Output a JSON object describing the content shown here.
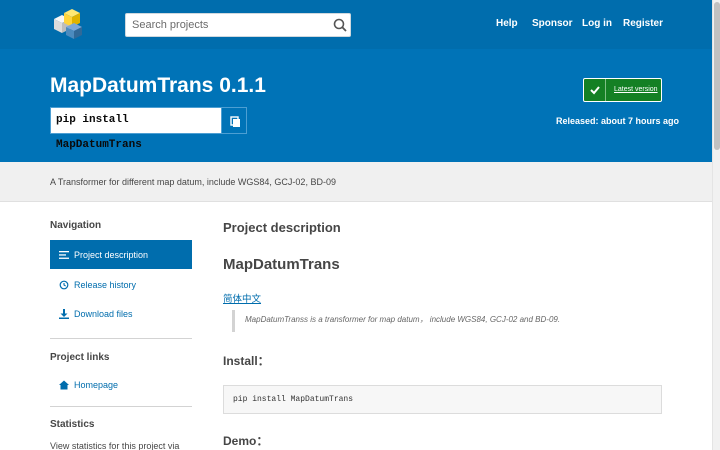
{
  "header": {
    "logo_icon": "pypi-logo-icon",
    "search_placeholder": "Search projects",
    "search_icon": "search-icon",
    "nav": [
      "Help",
      "Sponsor",
      "Log in",
      "Register"
    ]
  },
  "hero": {
    "title": "MapDatumTrans 0.1.1",
    "pip_command": "pip install MapDatumTrans",
    "copy_icon": "copy-icon",
    "latest_label": "Latest version",
    "latest_icon": "check-icon",
    "released": "Released: about 7 hours ago"
  },
  "summary": "A Transformer for different map datum, include WGS84, GCJ-02, BD-09",
  "sidebar": {
    "navigation_heading": "Navigation",
    "nav_items": [
      {
        "label": "Project description",
        "icon": "list-icon",
        "active": true
      },
      {
        "label": "Release history",
        "icon": "history-icon",
        "active": false
      },
      {
        "label": "Download files",
        "icon": "download-icon",
        "active": false
      }
    ],
    "links_heading": "Project links",
    "links": [
      {
        "label": "Homepage",
        "icon": "home-icon"
      }
    ],
    "statistics_heading": "Statistics",
    "statistics_text": "View statistics for this project via"
  },
  "main": {
    "section_title": "Project description",
    "readme_title": "MapDatumTrans",
    "link_zh": "简体中文",
    "quote": "MapDatumTranss is a transformer for map datum， include WGS84, GCJ-02 and BD-09.",
    "install_heading": "Install：",
    "install_code": "pip install MapDatumTrans",
    "demo_heading": "Demo："
  },
  "colors": {
    "header_blue": "#006dad",
    "hero_blue": "#0073b7",
    "latest_green": "#148024"
  }
}
